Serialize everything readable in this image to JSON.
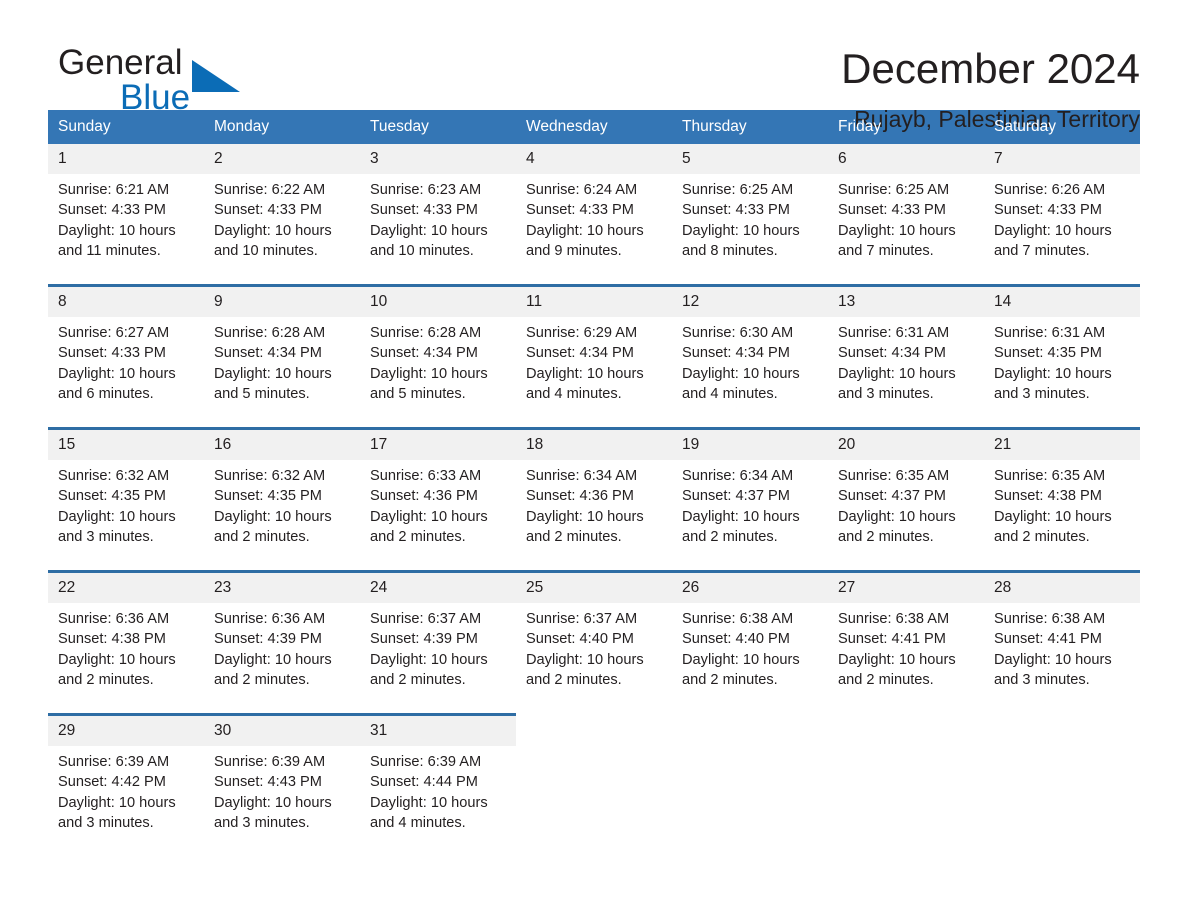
{
  "logo": {
    "word_one": "General",
    "word_two": "Blue",
    "triangle_icon": "triangle-icon",
    "accent_color": "#0b6cb6"
  },
  "header": {
    "month_title": "December 2024",
    "location": "Rujayb, Palestinian Territory"
  },
  "theme": {
    "header_blue": "#3476b5",
    "separator_blue": "#2e6da4",
    "daynum_bg": "#f1f1f1",
    "text_color": "#231f20"
  },
  "weekday_headers": [
    "Sunday",
    "Monday",
    "Tuesday",
    "Wednesday",
    "Thursday",
    "Friday",
    "Saturday"
  ],
  "weeks": [
    {
      "days": [
        {
          "num": "1",
          "sunrise": "Sunrise: 6:21 AM",
          "sunset": "Sunset: 4:33 PM",
          "daylight_1": "Daylight: 10 hours",
          "daylight_2": "and 11 minutes."
        },
        {
          "num": "2",
          "sunrise": "Sunrise: 6:22 AM",
          "sunset": "Sunset: 4:33 PM",
          "daylight_1": "Daylight: 10 hours",
          "daylight_2": "and 10 minutes."
        },
        {
          "num": "3",
          "sunrise": "Sunrise: 6:23 AM",
          "sunset": "Sunset: 4:33 PM",
          "daylight_1": "Daylight: 10 hours",
          "daylight_2": "and 10 minutes."
        },
        {
          "num": "4",
          "sunrise": "Sunrise: 6:24 AM",
          "sunset": "Sunset: 4:33 PM",
          "daylight_1": "Daylight: 10 hours",
          "daylight_2": "and 9 minutes."
        },
        {
          "num": "5",
          "sunrise": "Sunrise: 6:25 AM",
          "sunset": "Sunset: 4:33 PM",
          "daylight_1": "Daylight: 10 hours",
          "daylight_2": "and 8 minutes."
        },
        {
          "num": "6",
          "sunrise": "Sunrise: 6:25 AM",
          "sunset": "Sunset: 4:33 PM",
          "daylight_1": "Daylight: 10 hours",
          "daylight_2": "and 7 minutes."
        },
        {
          "num": "7",
          "sunrise": "Sunrise: 6:26 AM",
          "sunset": "Sunset: 4:33 PM",
          "daylight_1": "Daylight: 10 hours",
          "daylight_2": "and 7 minutes."
        }
      ]
    },
    {
      "days": [
        {
          "num": "8",
          "sunrise": "Sunrise: 6:27 AM",
          "sunset": "Sunset: 4:33 PM",
          "daylight_1": "Daylight: 10 hours",
          "daylight_2": "and 6 minutes."
        },
        {
          "num": "9",
          "sunrise": "Sunrise: 6:28 AM",
          "sunset": "Sunset: 4:34 PM",
          "daylight_1": "Daylight: 10 hours",
          "daylight_2": "and 5 minutes."
        },
        {
          "num": "10",
          "sunrise": "Sunrise: 6:28 AM",
          "sunset": "Sunset: 4:34 PM",
          "daylight_1": "Daylight: 10 hours",
          "daylight_2": "and 5 minutes."
        },
        {
          "num": "11",
          "sunrise": "Sunrise: 6:29 AM",
          "sunset": "Sunset: 4:34 PM",
          "daylight_1": "Daylight: 10 hours",
          "daylight_2": "and 4 minutes."
        },
        {
          "num": "12",
          "sunrise": "Sunrise: 6:30 AM",
          "sunset": "Sunset: 4:34 PM",
          "daylight_1": "Daylight: 10 hours",
          "daylight_2": "and 4 minutes."
        },
        {
          "num": "13",
          "sunrise": "Sunrise: 6:31 AM",
          "sunset": "Sunset: 4:34 PM",
          "daylight_1": "Daylight: 10 hours",
          "daylight_2": "and 3 minutes."
        },
        {
          "num": "14",
          "sunrise": "Sunrise: 6:31 AM",
          "sunset": "Sunset: 4:35 PM",
          "daylight_1": "Daylight: 10 hours",
          "daylight_2": "and 3 minutes."
        }
      ]
    },
    {
      "days": [
        {
          "num": "15",
          "sunrise": "Sunrise: 6:32 AM",
          "sunset": "Sunset: 4:35 PM",
          "daylight_1": "Daylight: 10 hours",
          "daylight_2": "and 3 minutes."
        },
        {
          "num": "16",
          "sunrise": "Sunrise: 6:32 AM",
          "sunset": "Sunset: 4:35 PM",
          "daylight_1": "Daylight: 10 hours",
          "daylight_2": "and 2 minutes."
        },
        {
          "num": "17",
          "sunrise": "Sunrise: 6:33 AM",
          "sunset": "Sunset: 4:36 PM",
          "daylight_1": "Daylight: 10 hours",
          "daylight_2": "and 2 minutes."
        },
        {
          "num": "18",
          "sunrise": "Sunrise: 6:34 AM",
          "sunset": "Sunset: 4:36 PM",
          "daylight_1": "Daylight: 10 hours",
          "daylight_2": "and 2 minutes."
        },
        {
          "num": "19",
          "sunrise": "Sunrise: 6:34 AM",
          "sunset": "Sunset: 4:37 PM",
          "daylight_1": "Daylight: 10 hours",
          "daylight_2": "and 2 minutes."
        },
        {
          "num": "20",
          "sunrise": "Sunrise: 6:35 AM",
          "sunset": "Sunset: 4:37 PM",
          "daylight_1": "Daylight: 10 hours",
          "daylight_2": "and 2 minutes."
        },
        {
          "num": "21",
          "sunrise": "Sunrise: 6:35 AM",
          "sunset": "Sunset: 4:38 PM",
          "daylight_1": "Daylight: 10 hours",
          "daylight_2": "and 2 minutes."
        }
      ]
    },
    {
      "days": [
        {
          "num": "22",
          "sunrise": "Sunrise: 6:36 AM",
          "sunset": "Sunset: 4:38 PM",
          "daylight_1": "Daylight: 10 hours",
          "daylight_2": "and 2 minutes."
        },
        {
          "num": "23",
          "sunrise": "Sunrise: 6:36 AM",
          "sunset": "Sunset: 4:39 PM",
          "daylight_1": "Daylight: 10 hours",
          "daylight_2": "and 2 minutes."
        },
        {
          "num": "24",
          "sunrise": "Sunrise: 6:37 AM",
          "sunset": "Sunset: 4:39 PM",
          "daylight_1": "Daylight: 10 hours",
          "daylight_2": "and 2 minutes."
        },
        {
          "num": "25",
          "sunrise": "Sunrise: 6:37 AM",
          "sunset": "Sunset: 4:40 PM",
          "daylight_1": "Daylight: 10 hours",
          "daylight_2": "and 2 minutes."
        },
        {
          "num": "26",
          "sunrise": "Sunrise: 6:38 AM",
          "sunset": "Sunset: 4:40 PM",
          "daylight_1": "Daylight: 10 hours",
          "daylight_2": "and 2 minutes."
        },
        {
          "num": "27",
          "sunrise": "Sunrise: 6:38 AM",
          "sunset": "Sunset: 4:41 PM",
          "daylight_1": "Daylight: 10 hours",
          "daylight_2": "and 2 minutes."
        },
        {
          "num": "28",
          "sunrise": "Sunrise: 6:38 AM",
          "sunset": "Sunset: 4:41 PM",
          "daylight_1": "Daylight: 10 hours",
          "daylight_2": "and 3 minutes."
        }
      ]
    },
    {
      "days": [
        {
          "num": "29",
          "sunrise": "Sunrise: 6:39 AM",
          "sunset": "Sunset: 4:42 PM",
          "daylight_1": "Daylight: 10 hours",
          "daylight_2": "and 3 minutes."
        },
        {
          "num": "30",
          "sunrise": "Sunrise: 6:39 AM",
          "sunset": "Sunset: 4:43 PM",
          "daylight_1": "Daylight: 10 hours",
          "daylight_2": "and 3 minutes."
        },
        {
          "num": "31",
          "sunrise": "Sunrise: 6:39 AM",
          "sunset": "Sunset: 4:44 PM",
          "daylight_1": "Daylight: 10 hours",
          "daylight_2": "and 4 minutes."
        },
        {
          "num": "",
          "sunrise": "",
          "sunset": "",
          "daylight_1": "",
          "daylight_2": ""
        },
        {
          "num": "",
          "sunrise": "",
          "sunset": "",
          "daylight_1": "",
          "daylight_2": ""
        },
        {
          "num": "",
          "sunrise": "",
          "sunset": "",
          "daylight_1": "",
          "daylight_2": ""
        },
        {
          "num": "",
          "sunrise": "",
          "sunset": "",
          "daylight_1": "",
          "daylight_2": ""
        }
      ]
    }
  ]
}
